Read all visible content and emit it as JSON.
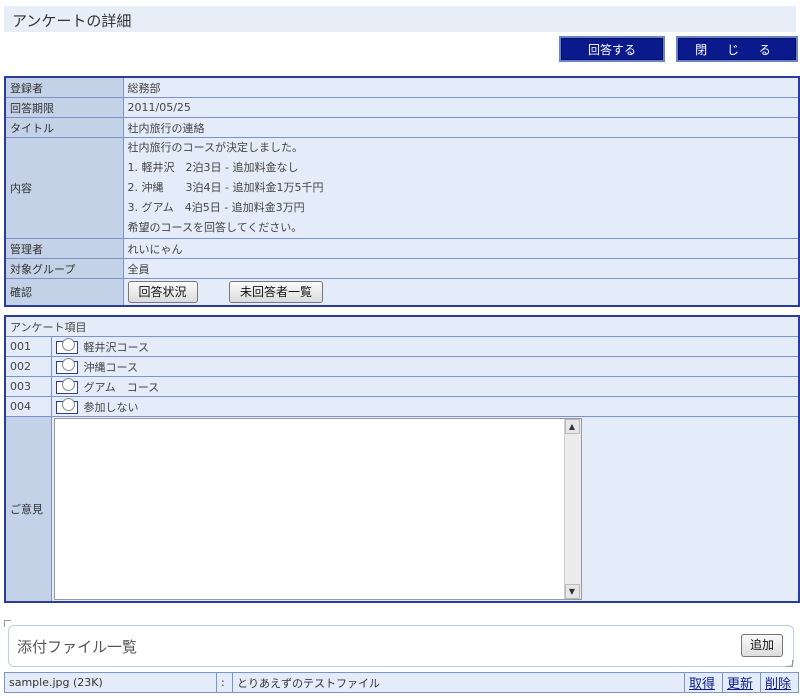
{
  "header": {
    "title": "アンケートの詳細"
  },
  "actions": {
    "answer": "回答する",
    "close": "閉 じ る"
  },
  "info": {
    "registrant_label": "登録者",
    "registrant": "総務部",
    "deadline_label": "回答期限",
    "deadline": "2011/05/25",
    "title_label": "タイトル",
    "title": "社内旅行の連絡",
    "content_label": "内容",
    "content_lines": [
      "社内旅行のコースが決定しました。",
      "1. 軽井沢　2泊3日 - 追加料金なし",
      "2. 沖縄　　3泊4日 - 追加料金1万5千円",
      "3. グアム　4泊5日 - 追加料金3万円",
      "希望のコースを回答してください。"
    ],
    "manager_label": "管理者",
    "manager": "れいにゃん",
    "group_label": "対象グループ",
    "group": "全員",
    "confirm_label": "確認",
    "status_button": "回答状況",
    "unanswered_button": "未回答者一覧"
  },
  "survey": {
    "heading": "アンケート項目",
    "items": [
      {
        "no": "001",
        "label": "軽井沢コース"
      },
      {
        "no": "002",
        "label": "沖縄コース"
      },
      {
        "no": "003",
        "label": "グアム　コース"
      },
      {
        "no": "004",
        "label": "参加しない"
      }
    ],
    "opinion_label": "ご意見",
    "opinion_value": ""
  },
  "attachments": {
    "title": "添付ファイル一覧",
    "add_button": "追加",
    "file": {
      "name": "sample.jpg (23K)",
      "sep": ":",
      "description": "とりあえずのテストファイル",
      "get": "取得",
      "update": "更新",
      "delete": "削除"
    }
  }
}
